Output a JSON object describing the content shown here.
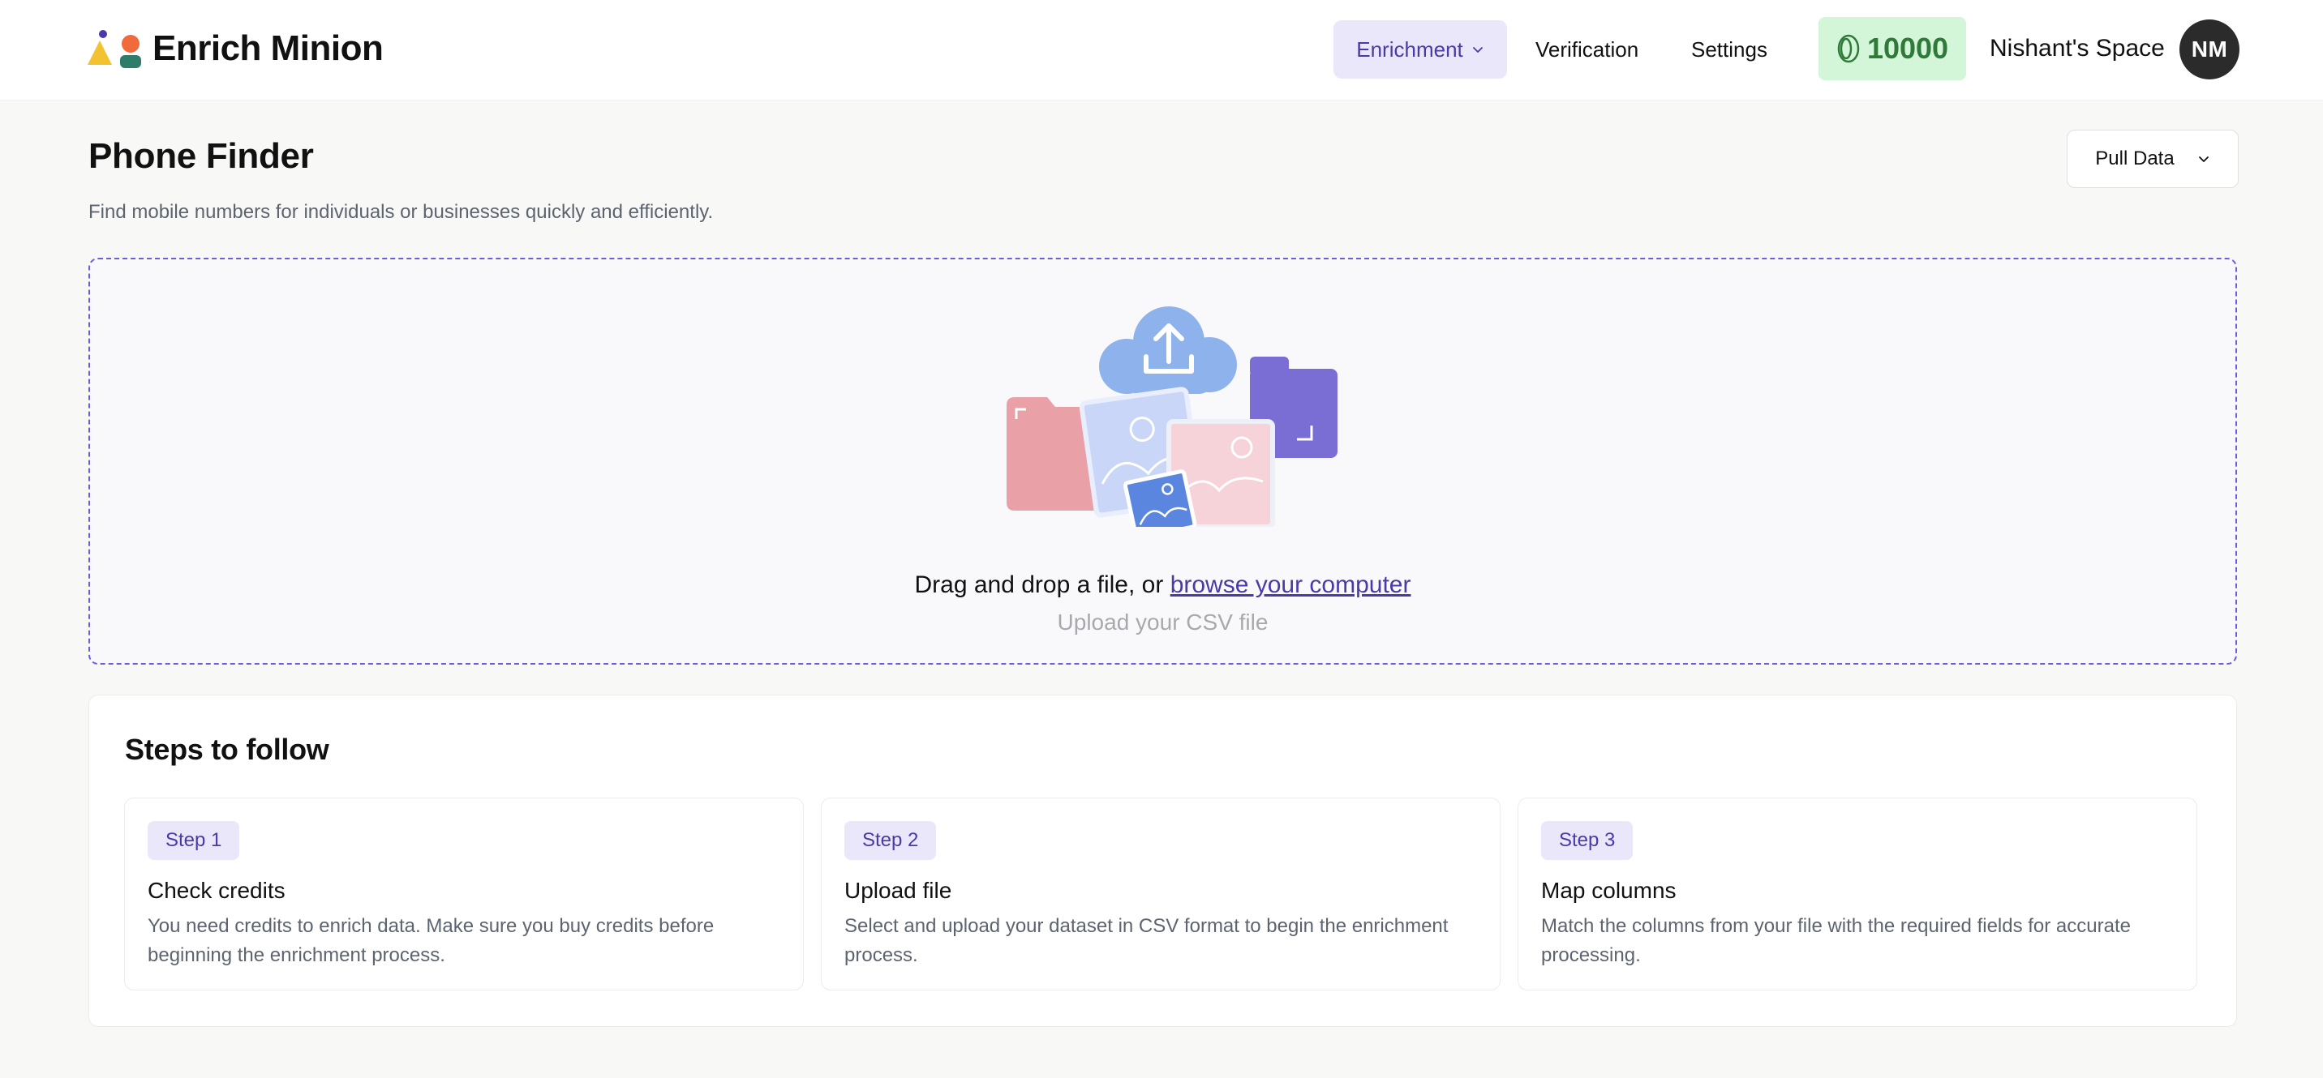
{
  "app": {
    "name": "Enrich Minion"
  },
  "nav": {
    "enrichment": "Enrichment",
    "verification": "Verification",
    "settings": "Settings"
  },
  "credits": {
    "value": "10000",
    "color": "#2f7a3a",
    "background": "#d3f5d8",
    "icon": "coin-icon"
  },
  "user": {
    "space_name": "Nishant's Space",
    "initials": "NM"
  },
  "page": {
    "title": "Phone Finder",
    "subtitle": "Find mobile numbers for individuals or businesses quickly and efficiently.",
    "pull_data_label": "Pull Data"
  },
  "upload": {
    "prompt": "Drag and drop a file, or ",
    "browse_link": "browse your computer",
    "hint": "Upload your CSV file",
    "icon": "cloud-upload-icon"
  },
  "steps": {
    "title": "Steps to follow",
    "items": [
      {
        "badge": "Step 1",
        "title": "Check credits",
        "description": "You need credits to enrich data. Make sure you buy credits before beginning the enrichment process."
      },
      {
        "badge": "Step 2",
        "title": "Upload file",
        "description": "Select and upload your dataset in CSV format to begin the enrichment process."
      },
      {
        "badge": "Step 3",
        "title": "Map columns",
        "description": "Match the columns from your file with the required fields for accurate processing."
      }
    ]
  },
  "colors": {
    "accent": "#4a3aa8",
    "accent_soft": "#ebe7fb",
    "dashed_border": "#6b5ce0",
    "page_background": "#f8f8f6"
  }
}
